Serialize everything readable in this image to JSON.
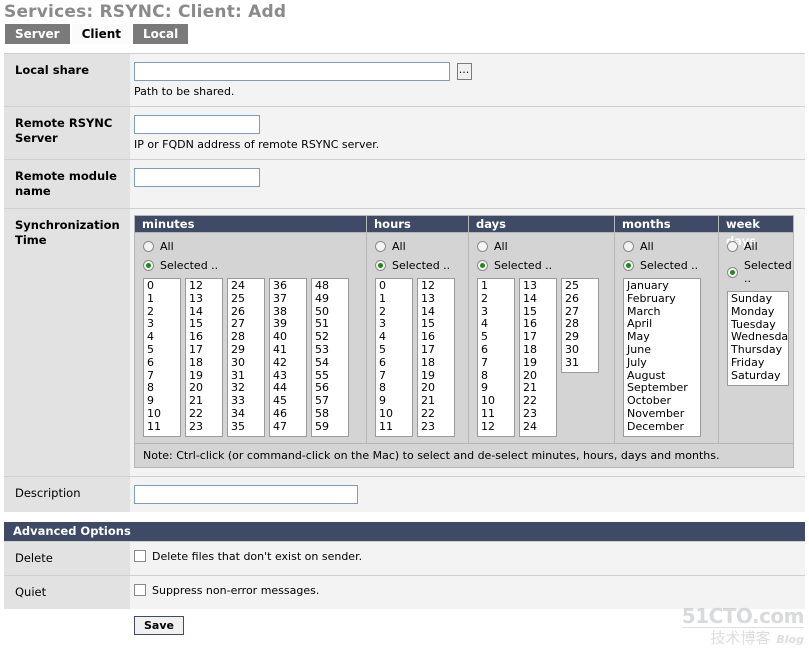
{
  "page": {
    "title": "Services: RSYNC: Client: Add"
  },
  "tabs": [
    {
      "label": "Server",
      "active": false
    },
    {
      "label": "Client",
      "active": true
    },
    {
      "label": "Local",
      "active": false
    }
  ],
  "form": {
    "local_share": {
      "label": "Local share",
      "value": "",
      "placeholder": "",
      "hint": "Path to be shared.",
      "browse_label": "..."
    },
    "remote_server": {
      "label": "Remote RSYNC Server",
      "value": "",
      "placeholder": "",
      "hint": "IP or FQDN address of remote RSYNC server."
    },
    "remote_module": {
      "label": "Remote module name",
      "value": "",
      "placeholder": ""
    },
    "sync_time": {
      "label": "Synchronization Time",
      "note": "Note: Ctrl-click (or command-click on the Mac) to select and de-select minutes, hours, days and months.",
      "radio_all_label": "All",
      "radio_selected_label": "Selected ..",
      "columns": [
        {
          "header": "minutes",
          "key": "minutes",
          "selection": "selected",
          "lists": [
            [
              "0",
              "1",
              "2",
              "3",
              "4",
              "5",
              "6",
              "7",
              "8",
              "9",
              "10",
              "11"
            ],
            [
              "12",
              "13",
              "14",
              "15",
              "16",
              "17",
              "18",
              "19",
              "20",
              "21",
              "22",
              "23"
            ],
            [
              "24",
              "25",
              "26",
              "27",
              "28",
              "29",
              "30",
              "31",
              "32",
              "33",
              "34",
              "35"
            ],
            [
              "36",
              "37",
              "38",
              "39",
              "40",
              "41",
              "42",
              "43",
              "44",
              "45",
              "46",
              "47"
            ],
            [
              "48",
              "49",
              "50",
              "51",
              "52",
              "53",
              "54",
              "55",
              "56",
              "57",
              "58",
              "59"
            ]
          ]
        },
        {
          "header": "hours",
          "key": "hours",
          "selection": "selected",
          "lists": [
            [
              "0",
              "1",
              "2",
              "3",
              "4",
              "5",
              "6",
              "7",
              "8",
              "9",
              "10",
              "11"
            ],
            [
              "12",
              "13",
              "14",
              "15",
              "16",
              "17",
              "18",
              "19",
              "20",
              "21",
              "22",
              "23"
            ]
          ]
        },
        {
          "header": "days",
          "key": "days",
          "selection": "selected",
          "lists": [
            [
              "1",
              "2",
              "3",
              "4",
              "5",
              "6",
              "7",
              "8",
              "9",
              "10",
              "11",
              "12"
            ],
            [
              "13",
              "14",
              "15",
              "16",
              "17",
              "18",
              "19",
              "20",
              "21",
              "22",
              "23",
              "24"
            ],
            [
              "25",
              "26",
              "27",
              "28",
              "29",
              "30",
              "31"
            ]
          ]
        },
        {
          "header": "months",
          "key": "months",
          "selection": "selected",
          "lists": [
            [
              "January",
              "February",
              "March",
              "April",
              "May",
              "June",
              "July",
              "August",
              "September",
              "October",
              "November",
              "December"
            ]
          ]
        },
        {
          "header": "week days",
          "key": "weekdays",
          "selection": "selected",
          "lists": [
            [
              "Sunday",
              "Monday",
              "Tuesday",
              "Wednesday",
              "Thursday",
              "Friday",
              "Saturday"
            ]
          ]
        }
      ]
    },
    "description": {
      "label": "Description",
      "value": "",
      "placeholder": ""
    }
  },
  "advanced": {
    "header": "Advanced Options",
    "rows": [
      {
        "label": "Delete",
        "checkbox_label": "Delete files that don't exist on sender.",
        "checked": false
      },
      {
        "label": "Quiet",
        "checkbox_label": "Suppress non-error messages.",
        "checked": false
      }
    ]
  },
  "actions": {
    "save_label": "Save"
  },
  "watermark": {
    "top": "51CTO.com",
    "bottom": "技术博客",
    "blog": "Blog"
  },
  "colors": {
    "header_blue": "#3e4a66",
    "tab_inactive": "#7a7a7a",
    "label_bg": "#e2e2e2",
    "panel_bg": "#d4d4d4",
    "radio_dot": "#1f8a1f"
  }
}
